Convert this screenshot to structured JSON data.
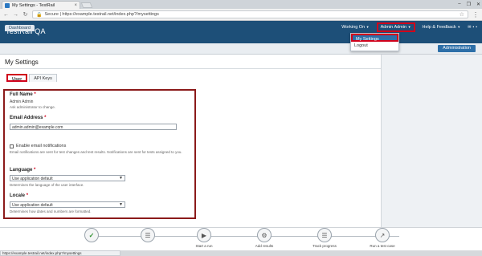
{
  "browser": {
    "tab_title": "My Settings - TestRail",
    "close_glyph": "×",
    "url": "Secure | https://example.testrail.net/index.php?/mysettings",
    "window_controls": [
      "–",
      "❐",
      "✕"
    ]
  },
  "app": {
    "logo": "TestRail QA",
    "nav": {
      "working_on": "Working On",
      "user_menu": "Admin Admin",
      "help": "Help & Feedback"
    },
    "dashboard_tab": "Dashboard",
    "admin_button": "Administration",
    "dropdown": [
      "My Settings",
      "Logout"
    ]
  },
  "page": {
    "title": "My Settings",
    "tabs": [
      "User",
      "API Keys"
    ]
  },
  "form": {
    "full_name_label": "Full Name",
    "full_name_value": "Admin Admin",
    "full_name_hint": "Ask administrator to change.",
    "email_label": "Email Address",
    "email_value": "admin.admin@example.com",
    "notif_label": "Enable email notifications",
    "notif_hint": "Email notifications are sent for test changes and test results. Notifications are sent for tests assigned to you.",
    "language_label": "Language",
    "language_value": "Use application default",
    "language_hint": "Determines the language of the user interface.",
    "locale_label": "Locale",
    "locale_value": "Use application default",
    "locale_hint": "Determines how dates and numbers are formatted."
  },
  "steps": [
    "",
    "",
    "Start a run",
    "Add results",
    "Track progress",
    "Run a test case"
  ],
  "status_url": "https://example.testrail.net/index.php?/mysettings"
}
